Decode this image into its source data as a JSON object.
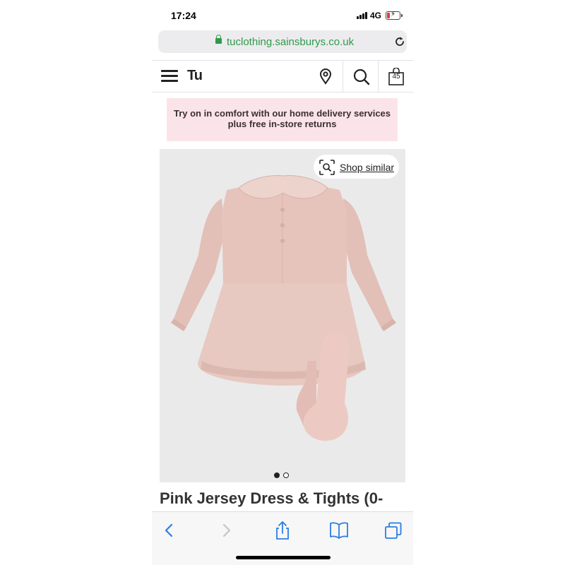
{
  "status_bar": {
    "time": "17:24",
    "network": "4G"
  },
  "browser": {
    "url": "tuclothing.sainsburys.co.uk"
  },
  "header": {
    "logo": "Tu",
    "bag_count": "45",
    "icons": [
      "menu-icon",
      "location-pin-icon",
      "search-icon",
      "shopping-bag-icon"
    ]
  },
  "promo": {
    "line1": "Try on in comfort with our home delivery services",
    "line2": "plus free in-store returns"
  },
  "product": {
    "shop_similar": "Shop similar",
    "title": "Pink Jersey Dress & Tights (0-",
    "image_dots": {
      "total": 2,
      "active": 1
    }
  },
  "toolbar": {
    "icons": [
      "back-icon",
      "forward-icon",
      "share-icon",
      "bookmarks-icon",
      "tabs-icon"
    ]
  },
  "colors": {
    "accent_green": "#2e9b4a",
    "promo_bg": "#fbe4e8",
    "dress_pink": "#e6c4bc",
    "image_bg": "#eaeaea"
  }
}
